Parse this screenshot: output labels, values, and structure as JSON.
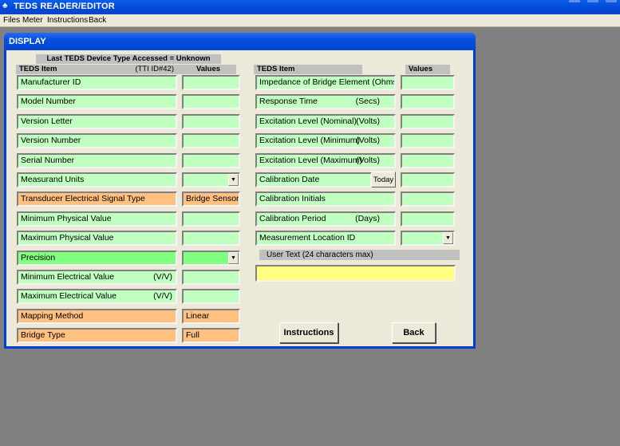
{
  "app": {
    "title": "TEDS READER/EDITOR",
    "menu": [
      "Files",
      "Meter",
      "Instructions",
      "Back"
    ]
  },
  "window": {
    "title": "DISPLAY",
    "last_device": "Last TEDS Device Type Accessed = Unknown",
    "left": {
      "item_header": "TEDS Item",
      "ttid": "(TTI ID#42)",
      "values_header": "Values",
      "rows": [
        {
          "label": "Manufacturer ID",
          "unit": "",
          "value": "",
          "color": "green",
          "type": "text"
        },
        {
          "label": "Model Number",
          "unit": "",
          "value": "",
          "color": "green",
          "type": "text"
        },
        {
          "label": "Version Letter",
          "unit": "",
          "value": "",
          "color": "green",
          "type": "text"
        },
        {
          "label": "Version Number",
          "unit": "",
          "value": "",
          "color": "green",
          "type": "text"
        },
        {
          "label": "Serial Number",
          "unit": "",
          "value": "",
          "color": "green",
          "type": "text"
        },
        {
          "label": "Measurand Units",
          "unit": "",
          "value": "",
          "color": "green",
          "type": "dropdown"
        },
        {
          "label": "Transducer Electrical Signal Type",
          "unit": "",
          "value": "Bridge Sensor",
          "color": "orange",
          "type": "text"
        },
        {
          "label": "Minimum Physical Value",
          "unit": "",
          "value": "",
          "color": "green",
          "type": "text"
        },
        {
          "label": "Maximum Physical Value",
          "unit": "",
          "value": "",
          "color": "green",
          "type": "text"
        },
        {
          "label": "Precision",
          "unit": "",
          "value": "",
          "color": "bright",
          "type": "dropdown"
        },
        {
          "label": "Minimum Electrical Value",
          "unit": "(V/V)",
          "value": "",
          "color": "green",
          "type": "text"
        },
        {
          "label": "Maximum Electrical Value",
          "unit": "(V/V)",
          "value": "",
          "color": "green",
          "type": "text"
        },
        {
          "label": "Mapping Method",
          "unit": "",
          "value": "Linear",
          "color": "orange",
          "type": "text"
        },
        {
          "label": "Bridge Type",
          "unit": "",
          "value": "Full",
          "color": "orange",
          "type": "text"
        }
      ]
    },
    "right": {
      "item_header": "TEDS Item",
      "values_header": "Values",
      "rows": [
        {
          "label": "Impedance of Bridge Element (Ohms)",
          "unit": "",
          "value": "",
          "type": "text"
        },
        {
          "label": "Response Time",
          "unit": "(Secs)",
          "value": "",
          "type": "text"
        },
        {
          "label": "Excitation Level (Nominal)",
          "unit": "(Volts)",
          "value": "",
          "type": "text"
        },
        {
          "label": "Excitation Level (Minimum)",
          "unit": "(Volts)",
          "value": "",
          "type": "text"
        },
        {
          "label": "Excitation Level (Maximum)",
          "unit": "(Volts)",
          "value": "",
          "type": "text"
        },
        {
          "label": "Calibration Date",
          "unit": "",
          "value": "",
          "type": "date"
        },
        {
          "label": "Calibration Initials",
          "unit": "",
          "value": "",
          "type": "text"
        },
        {
          "label": "Calibration Period",
          "unit": "(Days)",
          "value": "",
          "type": "text"
        },
        {
          "label": "Measurement Location ID",
          "unit": "",
          "value": "",
          "type": "dropdown"
        }
      ],
      "today_label": "Today",
      "user_text_header": "User Text  (24 characters max)",
      "user_text_value": ""
    },
    "buttons": {
      "instructions": "Instructions",
      "back": "Back"
    }
  },
  "colors": {
    "green": "#c0ffc0",
    "orange": "#ffc080",
    "bright": "#80ff80",
    "yellow": "#ffff80",
    "titlebar": "#0348d8"
  }
}
